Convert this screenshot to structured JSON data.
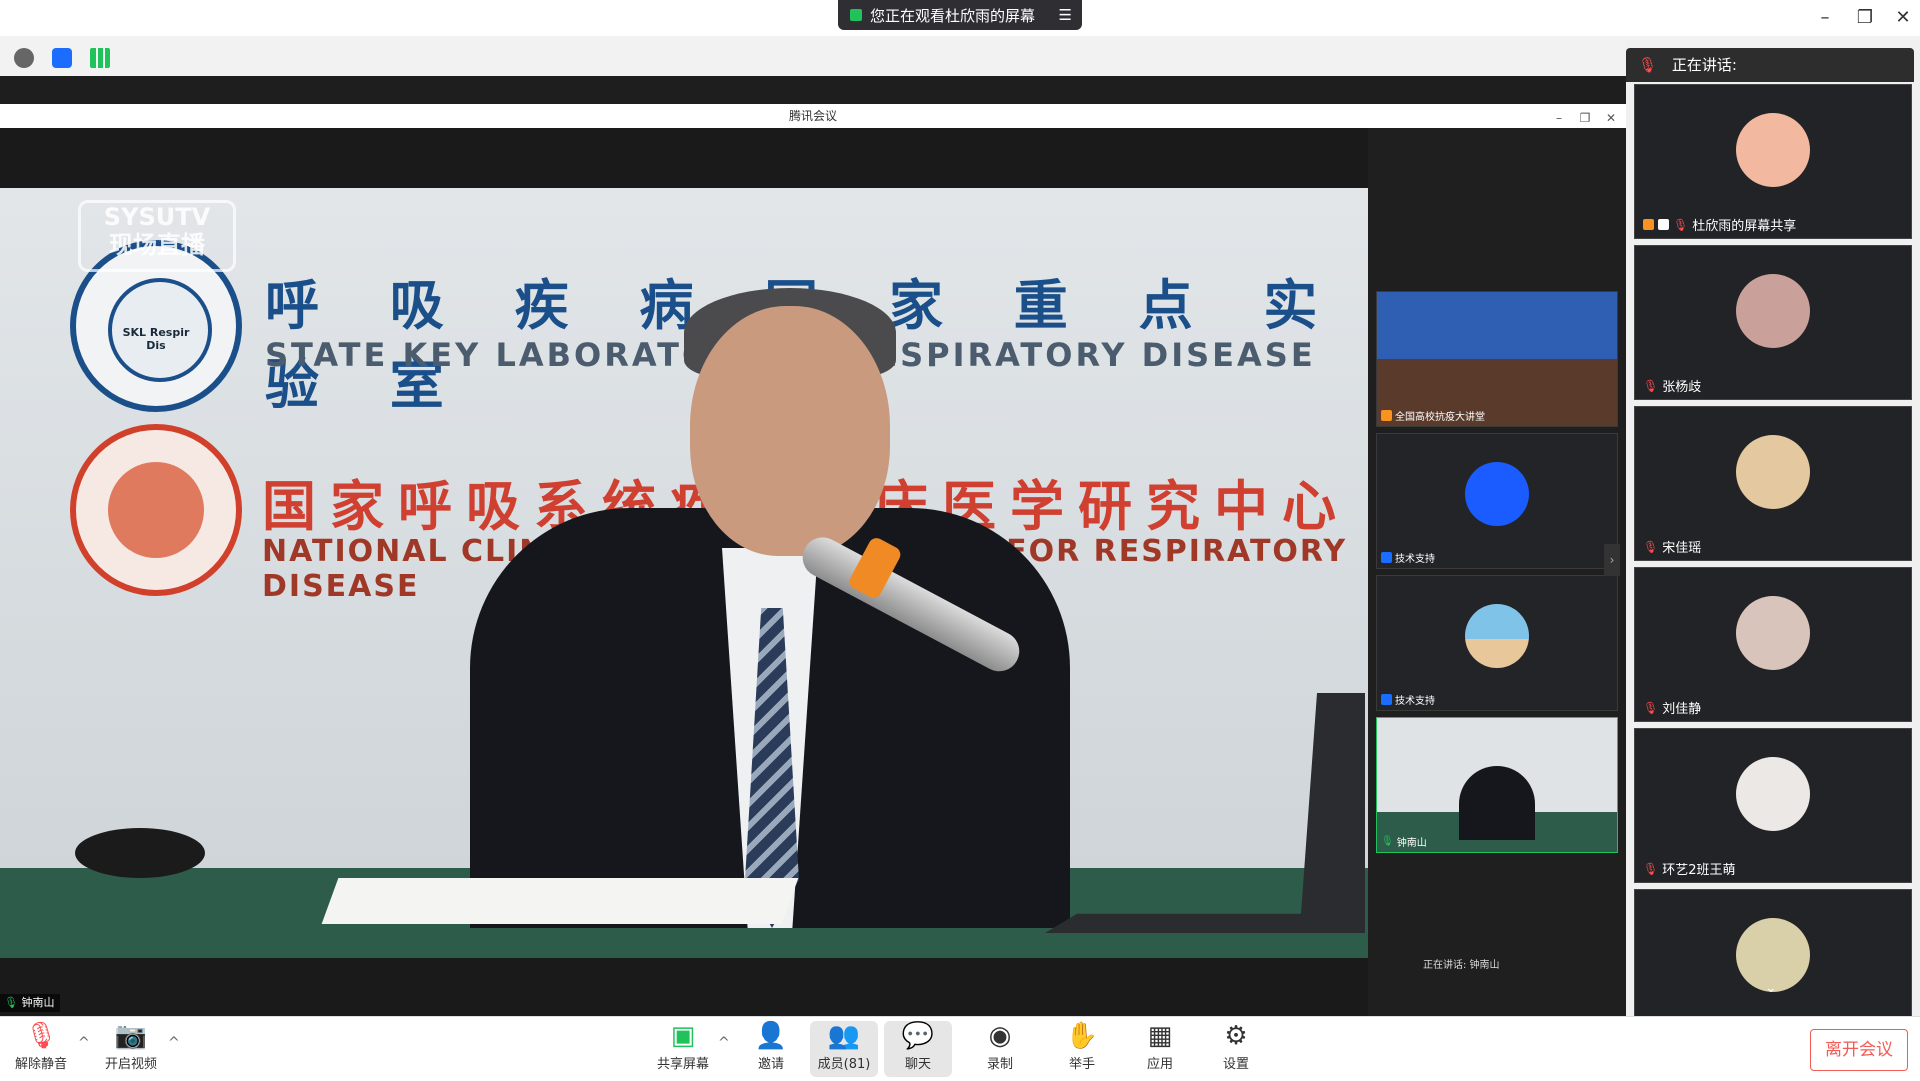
{
  "top_banner": {
    "text": "您正在观看杜欣雨的屏幕"
  },
  "inner_window": {
    "title": "腾讯会议"
  },
  "main_video": {
    "watermark": "SYSUTV\n现场直播",
    "sign_cn_1": "呼 吸 疾 病 国 家 重 点 实 验 室",
    "sign_en_1": "STATE KEY LABORATORY OF RESPIRATORY DISEASE",
    "sign_cn_2": "国家呼吸系统疾病临床医学研究中心",
    "sign_en_2": "NATIONAL CLINICAL RESEARCH CENTER FOR RESPIRATORY DISEASE",
    "logo_text": "SKL Respir Dis",
    "name_tag": "钟南山"
  },
  "thumbnails": [
    {
      "name": "全国高校抗疫大讲堂",
      "badge_color": "#f7931e"
    },
    {
      "name": "技术支持",
      "badge_color": "#1a6dff"
    },
    {
      "name": "技术支持",
      "badge_color": "#1a6dff"
    },
    {
      "name": "钟南山",
      "badge_color": "#1fc25b"
    }
  ],
  "speaking_mini": "正在讲话: 钟南山",
  "right_panel": {
    "header": "正在讲话:",
    "participants": [
      {
        "name": "杜欣雨的屏幕共享",
        "avatar_color": "#f2b8a0"
      },
      {
        "name": "张杨歧",
        "avatar_color": "#c9a09a"
      },
      {
        "name": "宋佳瑶",
        "avatar_color": "#e4c9a0"
      },
      {
        "name": "刘佳静",
        "avatar_color": "#d8c4bb"
      },
      {
        "name": "环艺2班王萌",
        "avatar_color": "#ece8e6"
      },
      {
        "name": "",
        "avatar_color": "#d9cfa8"
      }
    ]
  },
  "bottom_bar": {
    "unmute": "解除静音",
    "video": "开启视频",
    "share": "共享屏幕",
    "invite": "邀请",
    "members": "成员(81)",
    "chat": "聊天",
    "record": "录制",
    "raise_hand": "举手",
    "apps": "应用",
    "settings": "设置",
    "leave": "离开会议"
  }
}
